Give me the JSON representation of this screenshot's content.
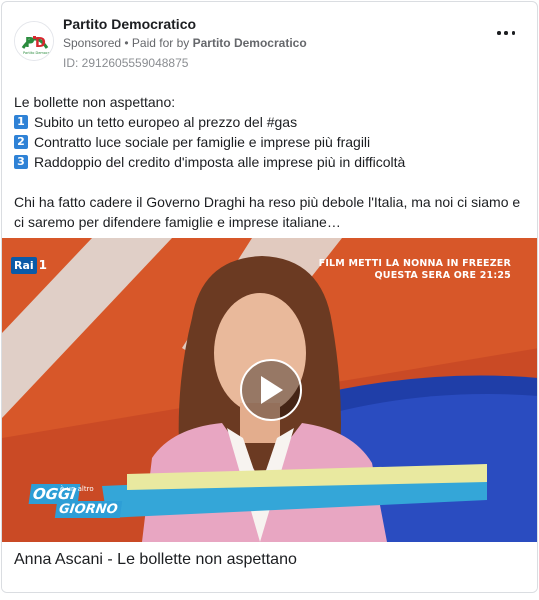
{
  "post": {
    "page_name": "Partito Democratico",
    "sponsored": "Sponsored",
    "paid_for_prefix": " • Paid for by ",
    "paid_for_by": "Partito Democratico",
    "ad_id": "ID: 2912605559048875",
    "intro": "Le bollette non aspettano:",
    "points": [
      {
        "num": "1",
        "text": "Subito un tetto europeo al prezzo del #gas"
      },
      {
        "num": "2",
        "text": "Contratto luce sociale per famiglie e imprese più fragili"
      },
      {
        "num": "3",
        "text": "Raddoppio del credito d'imposta alle imprese più in difficoltà"
      }
    ],
    "paragraph": "Chi ha fatto cadere il Governo Draghi ha reso più debole l'Italia, ma noi ci siamo e ci saremo per difendere famiglie e imprese italiane…"
  },
  "video": {
    "channel": "Rai",
    "channel_number": "1",
    "ticker_line1": "FILM METTI LA NONNA IN FREEZER",
    "ticker_line2": "QUESTA SERA ORE 21:25",
    "show_logo_1": "OGGI",
    "show_logo_2": "è un altro",
    "show_logo_3": "GIORNO",
    "caption": "Anna Ascani - Le bollette non aspettano"
  },
  "icons": {
    "more": "more-options-icon",
    "play": "play-icon",
    "logo": "pd-logo"
  },
  "colors": {
    "accent_blue": "#2f82d6",
    "text": "#1c1e21",
    "muted": "#65676b",
    "pd_green": "#2b8c3e",
    "pd_red": "#d7282f"
  }
}
